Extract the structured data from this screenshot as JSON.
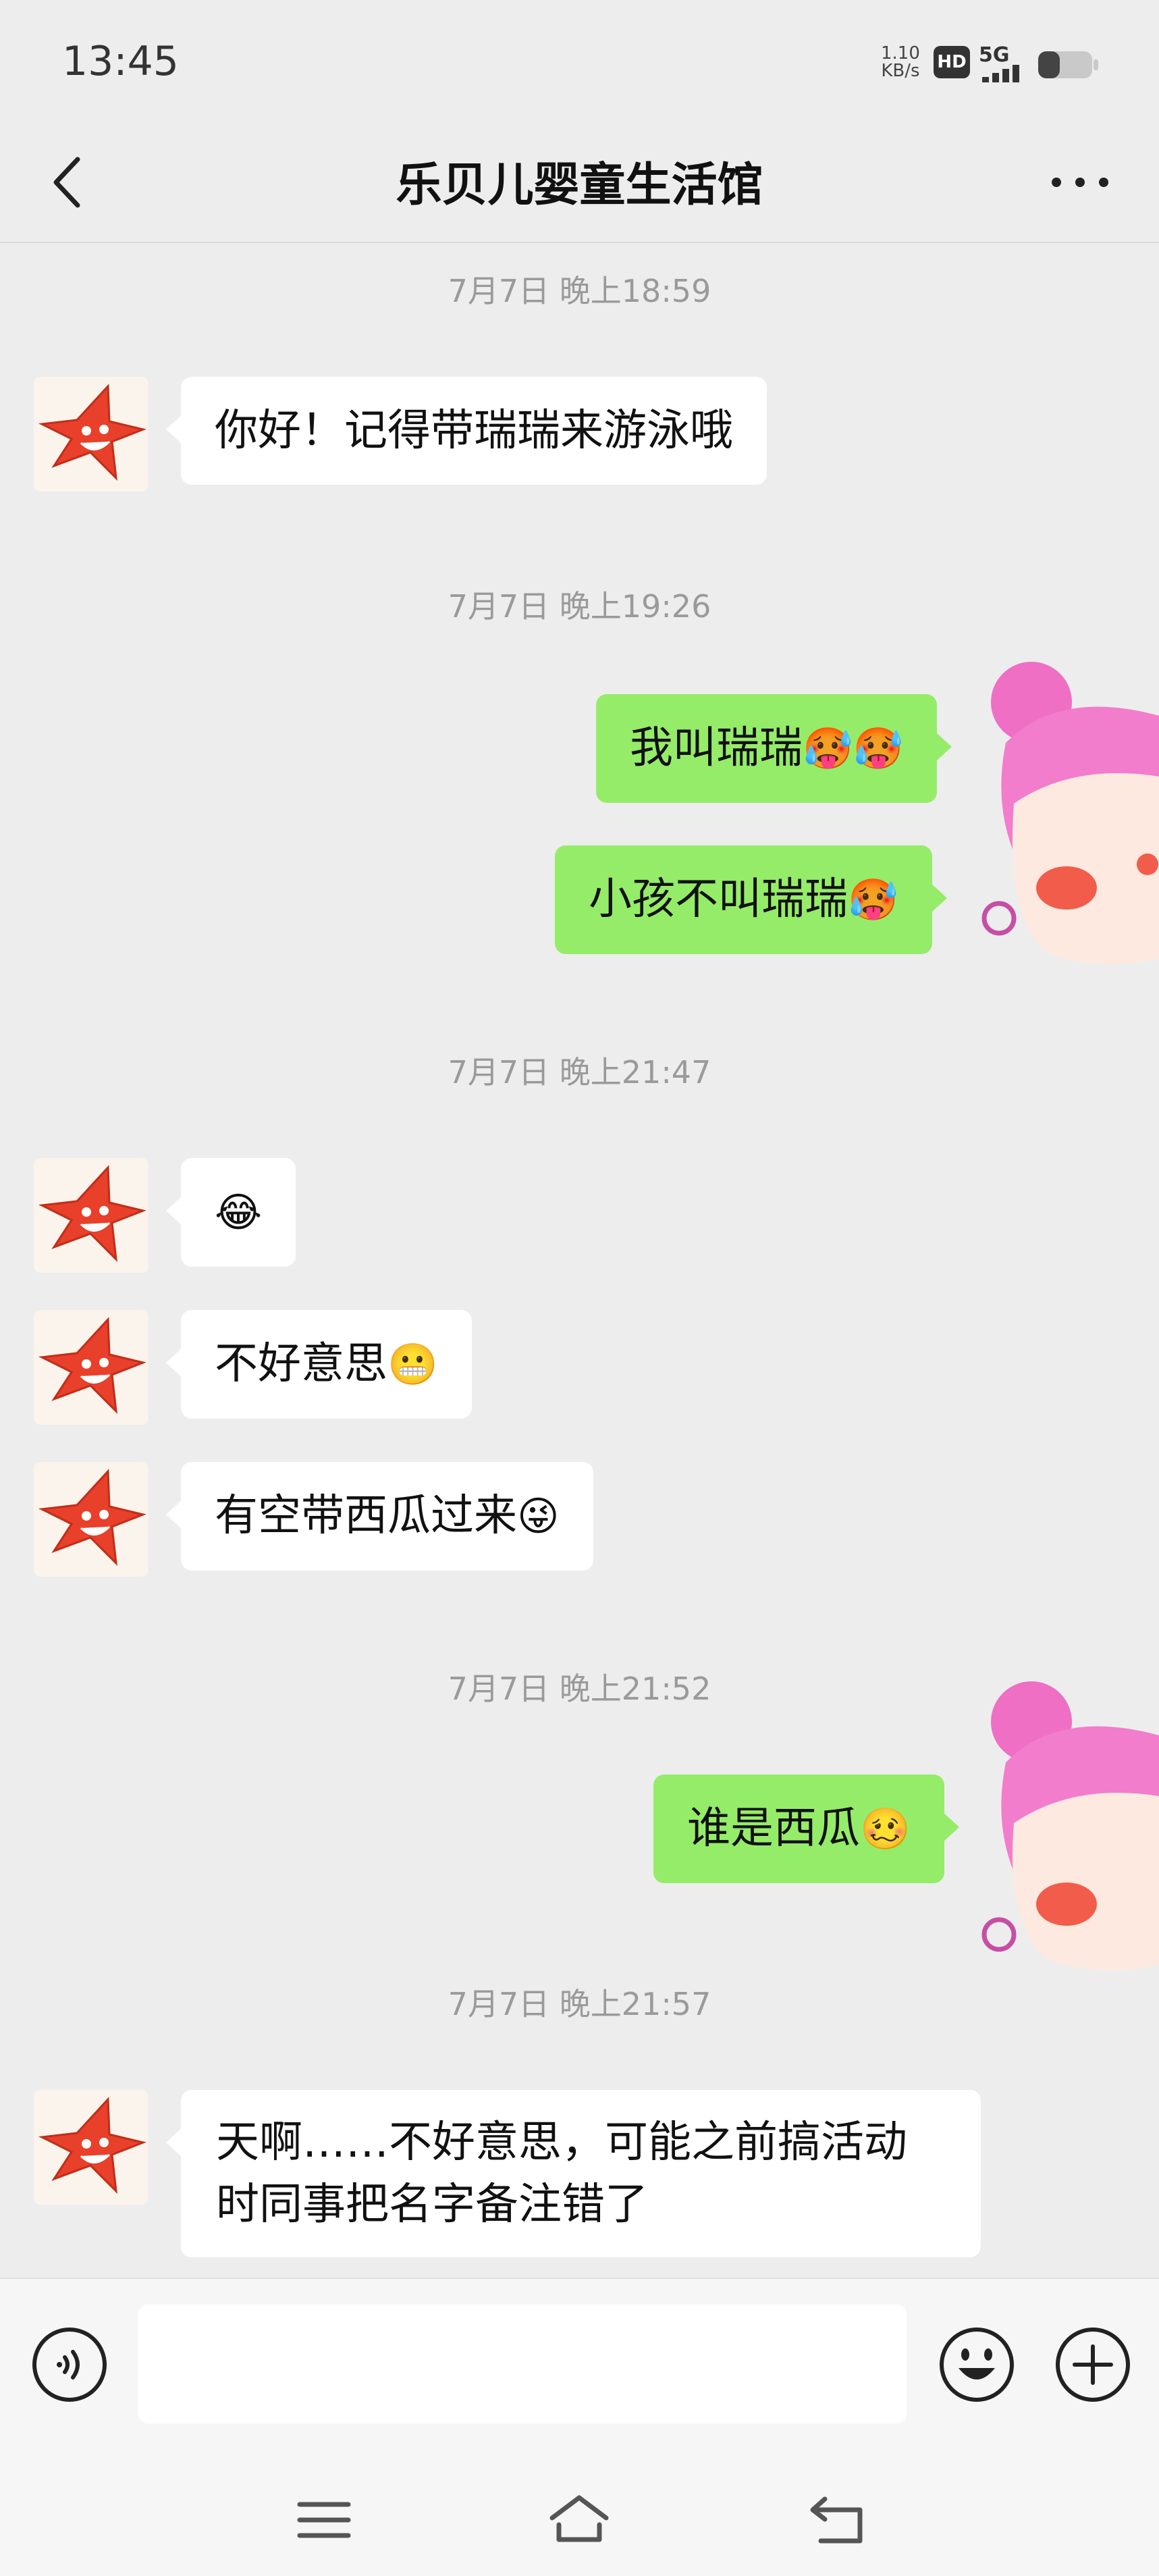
{
  "status_bar": {
    "time": "13:45",
    "net_speed_value": "1.10",
    "net_speed_unit": "KB/s",
    "hd_badge": "HD",
    "network": "5G",
    "icons": [
      "signal-icon",
      "battery-icon"
    ]
  },
  "nav": {
    "title": "乐贝儿婴童生活馆",
    "back_icon": "chevron-left-icon",
    "more_icon": "more-dots-icon"
  },
  "chat": {
    "timestamps": [
      "7月7日 晚上18:59",
      "7月7日 晚上19:26",
      "7月7日 晚上21:47",
      "7月7日 晚上21:52",
      "7月7日 晚上21:57"
    ],
    "messages": [
      {
        "sender": "contact",
        "text": "你好！记得带瑞瑞来游泳哦",
        "emoji": ""
      },
      {
        "sender": "self",
        "text": "我叫瑞瑞",
        "emoji": "🥵🥵"
      },
      {
        "sender": "self",
        "text": "小孩不叫瑞瑞",
        "emoji": "🥵"
      },
      {
        "sender": "contact",
        "text": "",
        "emoji": "😂"
      },
      {
        "sender": "contact",
        "text": "不好意思",
        "emoji": "😬"
      },
      {
        "sender": "contact",
        "text": "有空带西瓜过来",
        "emoji": "😜"
      },
      {
        "sender": "self",
        "text": "谁是西瓜",
        "emoji": "🥴"
      },
      {
        "sender": "contact",
        "text": "天啊……不好意思，可能之前搞活动时同事把名字备注错了",
        "emoji": ""
      }
    ]
  },
  "input_bar": {
    "placeholder": "",
    "icons": [
      "voice-icon",
      "emoji-face-icon",
      "plus-icon"
    ]
  },
  "system_nav": {
    "icons": [
      "menu-icon",
      "home-icon",
      "back-icon"
    ]
  },
  "colors": {
    "background": "#ededed",
    "incoming_bubble": "#ffffff",
    "outgoing_bubble": "#95ec69",
    "timestamp": "#9a9a9a"
  }
}
